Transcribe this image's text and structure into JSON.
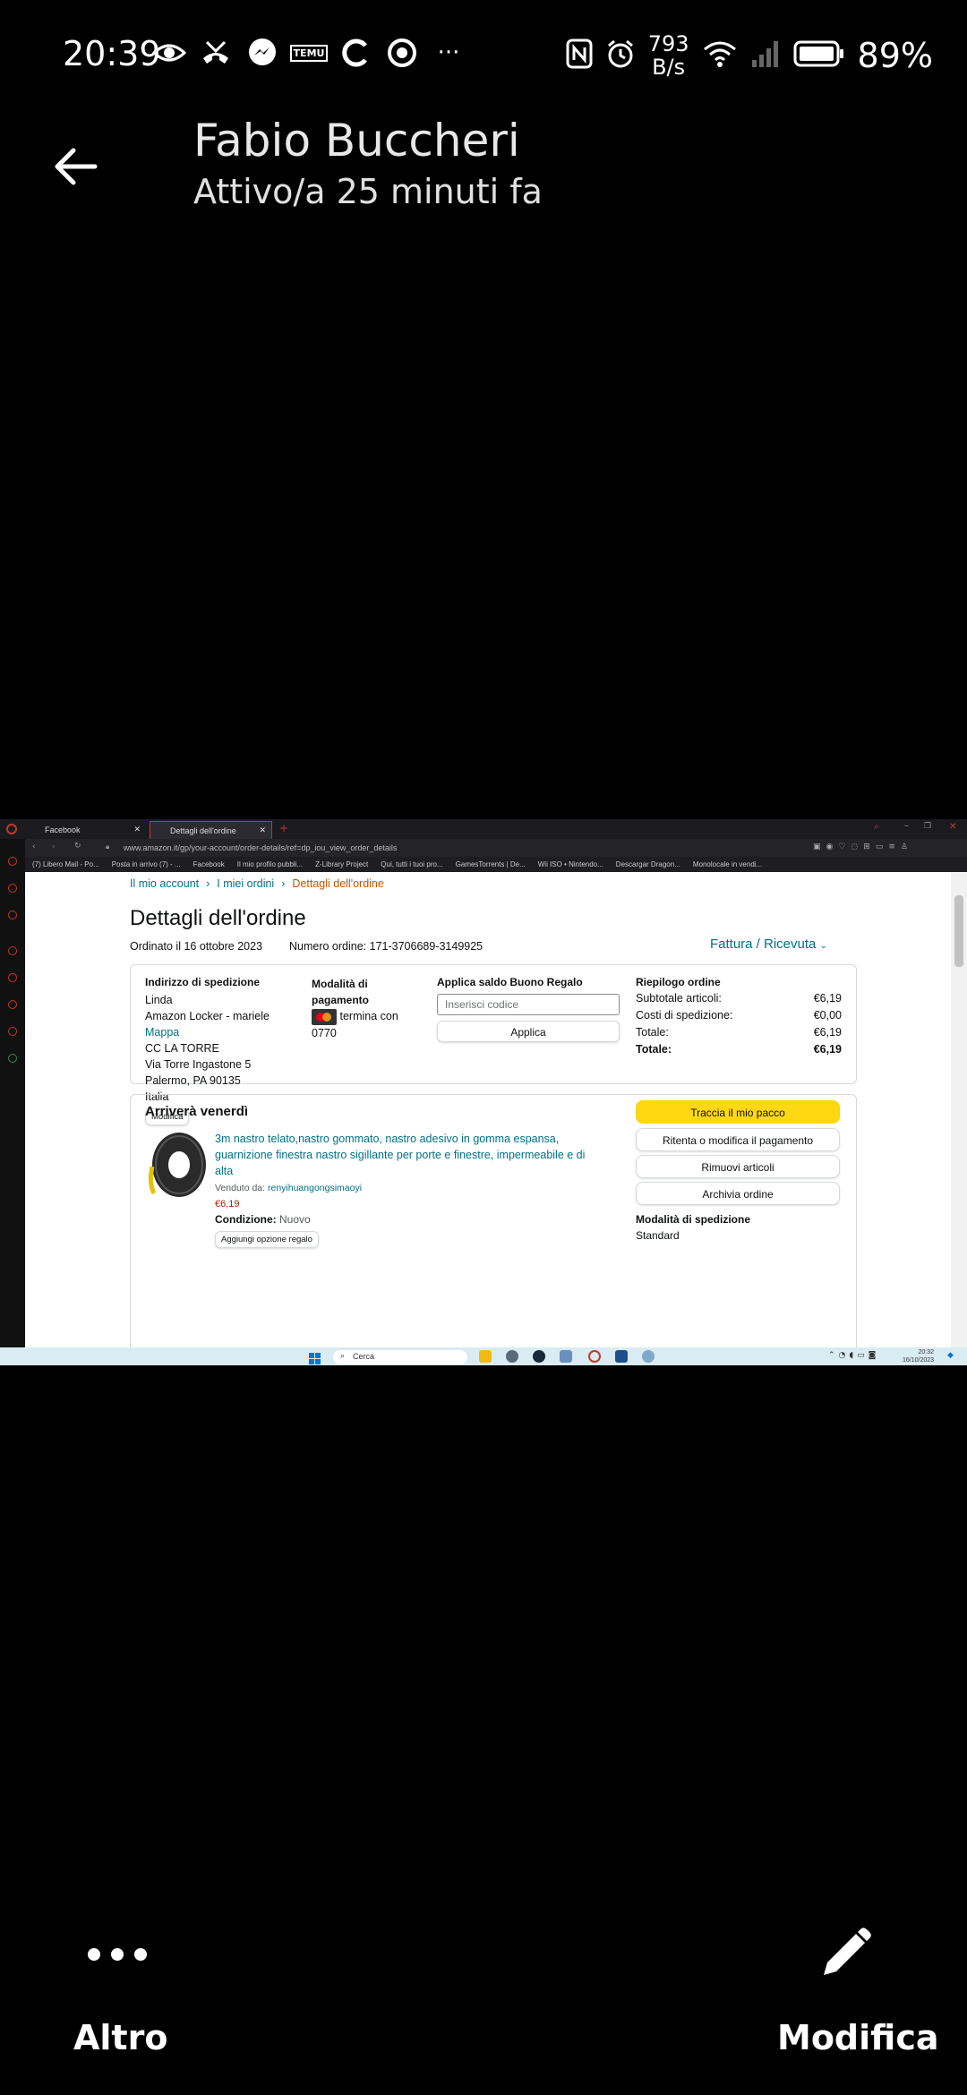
{
  "status_bar": {
    "time": "20:39",
    "net_speed_value": "793",
    "net_speed_unit": "B/s",
    "battery": "89%",
    "more": "···",
    "temu_label": "TEMU"
  },
  "header": {
    "contact_name": "Fabio Buccheri",
    "last_seen": "Attivo/a 25 minuti fa"
  },
  "browser": {
    "tabs": [
      {
        "label": "Facebook"
      },
      {
        "label": "Dettagli dell'ordine"
      }
    ],
    "url": "www.amazon.it/gp/your-account/order-details/ref=dp_iou_view_order_details",
    "bookmarks": [
      "(7) Libero Mail - Po...",
      "Posta in arrivo (7) - ...",
      "Facebook",
      "Il mio profilo pubbli...",
      "Z-Library Project",
      "Qui, tutti i tuoi pro...",
      "GamesTorrents | De...",
      "Wii ISO • Nintendo...",
      "Descargar Dragon...",
      "Monolocale in vendi..."
    ]
  },
  "amazon": {
    "breadcrumb": [
      "Il mio account",
      "I miei ordini",
      "Dettagli dell'ordine"
    ],
    "page_title": "Dettagli dell'ordine",
    "ordered_on": "Ordinato il 16 ottobre 2023",
    "order_number": "Numero ordine: 171-3706689-3149925",
    "invoice_link": "Fattura / Ricevuta",
    "shipping": {
      "heading": "Indirizzo di spedizione",
      "lines": [
        "Linda",
        "Amazon Locker - mariele"
      ],
      "map_link": "Mappa",
      "lines2": [
        "CC LA TORRE",
        "Via Torre Ingastone 5",
        "Palermo, PA 90135",
        "Italia"
      ],
      "edit_button": "Modifica"
    },
    "payment": {
      "heading": "Modalità di pagamento",
      "card_text": "termina con 0770"
    },
    "gift": {
      "heading": "Applica saldo Buono Regalo",
      "placeholder": "Inserisci codice",
      "apply_button": "Applica"
    },
    "summary": {
      "heading": "Riepilogo ordine",
      "rows": [
        {
          "label": "Subtotale articoli:",
          "value": "€6,19"
        },
        {
          "label": "Costi di spedizione:",
          "value": "€0,00"
        },
        {
          "label": "Totale:",
          "value": "€6,19"
        },
        {
          "label": "Totale:",
          "value": "€6,19"
        }
      ]
    },
    "delivery": {
      "heading": "Arriverà venerdì",
      "product_title": "3m nastro telato,nastro gommato, nastro adesivo in gomma espansa, guarnizione finestra nastro sigillante per porte e finestre, impermeabile e di alta",
      "sold_by_label": "Venduto da:",
      "seller": "renyihuangongsimaoyi",
      "price": "€6,19",
      "condition_label": "Condizione:",
      "condition_value": "Nuovo",
      "gift_button": "Aggiungi opzione regalo",
      "buttons": [
        "Traccia il mio pacco",
        "Ritenta o modifica il pagamento",
        "Rimuovi articoli",
        "Archivia ordine"
      ],
      "shipping_mode_heading": "Modalità di spedizione",
      "shipping_mode": "Standard"
    }
  },
  "taskbar": {
    "search": "Cerca",
    "time": "20:32",
    "date": "16/10/2023"
  },
  "bottom": {
    "more_label": "Altro",
    "edit_label": "Modifica"
  }
}
